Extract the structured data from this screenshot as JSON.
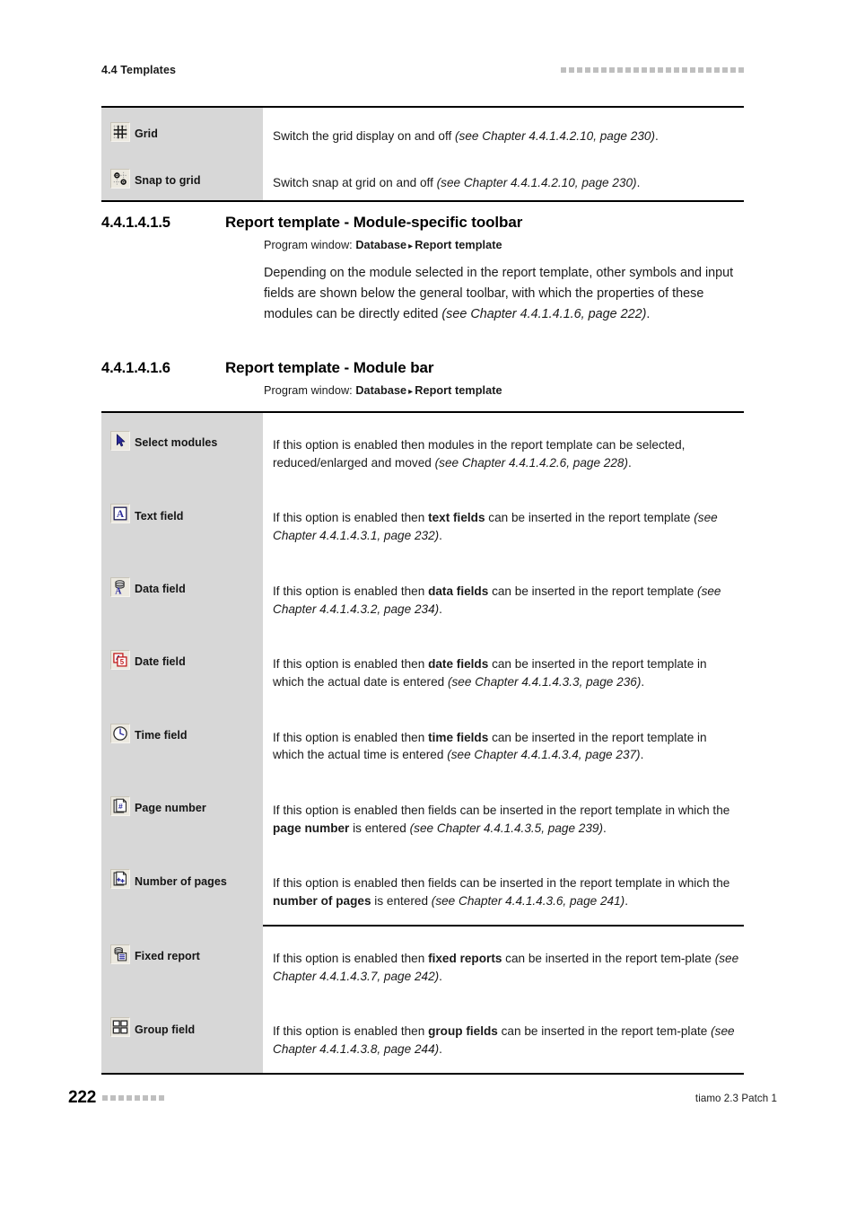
{
  "header": {
    "title": "4.4 Templates",
    "decoration_squares": 23
  },
  "footer": {
    "page_number": "222",
    "decoration_squares": 8,
    "product": "tiamo 2.3 Patch 1"
  },
  "top_table": {
    "rows": [
      {
        "icon": "grid-icon",
        "label": "Grid",
        "desc_pre": "Switch the grid display on and off ",
        "desc_ref": "(see Chapter 4.4.1.4.2.10, page 230)",
        "desc_post": "."
      },
      {
        "icon": "snap-to-grid-icon",
        "label": "Snap to grid",
        "desc_pre": "Switch snap at grid on and off ",
        "desc_ref": "(see Chapter 4.4.1.4.2.10, page 230)",
        "desc_post": "."
      }
    ]
  },
  "section_5": {
    "number": "4.4.1.4.1.5",
    "title": "Report template - Module-specific toolbar",
    "program_window_label": "Program window:",
    "program_window_path_1": "Database",
    "program_window_arrow": "▸",
    "program_window_path_2": "Report template",
    "paragraph_pre": "Depending on the module selected in the report template, other symbols and input fields are shown below the general toolbar, with which the properties of these modules can be directly edited ",
    "paragraph_ref": "(see Chapter 4.4.1.4.1.6, page 222)",
    "paragraph_post": "."
  },
  "section_6": {
    "number": "4.4.1.4.1.6",
    "title": "Report template - Module bar",
    "program_window_label": "Program window:",
    "program_window_path_1": "Database",
    "program_window_arrow": "▸",
    "program_window_path_2": "Report template"
  },
  "module_bar_table": {
    "rows": [
      {
        "icon": "select-modules-cursor-icon",
        "label": "Select modules",
        "parts": [
          {
            "text": "If this option is enabled then modules in the report template can be selected, reduced/enlarged and moved ",
            "style": "normal"
          },
          {
            "text": "(see Chapter 4.4.1.4.2.6, page 228)",
            "style": "italic"
          },
          {
            "text": ".",
            "style": "normal"
          }
        ],
        "separator_above": false
      },
      {
        "icon": "text-field-icon",
        "label": "Text field",
        "parts": [
          {
            "text": "If this option is enabled then ",
            "style": "normal"
          },
          {
            "text": "text fields",
            "style": "bold"
          },
          {
            "text": " can be inserted in the report template ",
            "style": "normal"
          },
          {
            "text": "(see Chapter 4.4.1.4.3.1, page 232)",
            "style": "italic"
          },
          {
            "text": ".",
            "style": "normal"
          }
        ],
        "separator_above": false
      },
      {
        "icon": "data-field-icon",
        "label": "Data field",
        "parts": [
          {
            "text": "If this option is enabled then ",
            "style": "normal"
          },
          {
            "text": "data fields",
            "style": "bold"
          },
          {
            "text": " can be inserted in the report template ",
            "style": "normal"
          },
          {
            "text": "(see Chapter 4.4.1.4.3.2, page 234)",
            "style": "italic"
          },
          {
            "text": ".",
            "style": "normal"
          }
        ],
        "separator_above": false
      },
      {
        "icon": "date-field-icon",
        "label": "Date field",
        "parts": [
          {
            "text": "If this option is enabled then ",
            "style": "normal"
          },
          {
            "text": "date fields",
            "style": "bold"
          },
          {
            "text": " can be inserted in the report template in which the actual date is entered ",
            "style": "normal"
          },
          {
            "text": "(see Chapter 4.4.1.4.3.3, page 236)",
            "style": "italic"
          },
          {
            "text": ".",
            "style": "normal"
          }
        ],
        "separator_above": false
      },
      {
        "icon": "time-field-clock-icon",
        "label": "Time field",
        "parts": [
          {
            "text": "If this option is enabled then ",
            "style": "normal"
          },
          {
            "text": "time fields",
            "style": "bold"
          },
          {
            "text": " can be inserted in the report template in which the actual time is entered ",
            "style": "normal"
          },
          {
            "text": "(see Chapter 4.4.1.4.3.4, page 237)",
            "style": "italic"
          },
          {
            "text": ".",
            "style": "normal"
          }
        ],
        "separator_above": false
      },
      {
        "icon": "page-number-icon",
        "label": "Page number",
        "parts": [
          {
            "text": "If this option is enabled then fields can be inserted in the report template in which the ",
            "style": "normal"
          },
          {
            "text": "page number",
            "style": "bold"
          },
          {
            "text": " is entered ",
            "style": "normal"
          },
          {
            "text": "(see Chapter 4.4.1.4.3.5, page 239)",
            "style": "italic"
          },
          {
            "text": ".",
            "style": "normal"
          }
        ],
        "separator_above": false
      },
      {
        "icon": "number-of-pages-icon",
        "label": "Number of pages",
        "parts": [
          {
            "text": "If this option is enabled then fields can be inserted in the report template in which the ",
            "style": "normal"
          },
          {
            "text": "number of pages",
            "style": "bold"
          },
          {
            "text": " is entered ",
            "style": "normal"
          },
          {
            "text": "(see Chapter 4.4.1.4.3.6, page 241)",
            "style": "italic"
          },
          {
            "text": ".",
            "style": "normal"
          }
        ],
        "separator_above": false
      },
      {
        "icon": "fixed-report-icon",
        "label": "Fixed report",
        "parts": [
          {
            "text": "If this option is enabled then ",
            "style": "normal"
          },
          {
            "text": "fixed reports",
            "style": "bold"
          },
          {
            "text": " can be inserted in the report tem-plate ",
            "style": "normal"
          },
          {
            "text": "(see Chapter 4.4.1.4.3.7, page 242)",
            "style": "italic"
          },
          {
            "text": ".",
            "style": "normal"
          }
        ],
        "separator_above": true
      },
      {
        "icon": "group-field-icon",
        "label": "Group field",
        "parts": [
          {
            "text": "If this option is enabled then ",
            "style": "normal"
          },
          {
            "text": "group fields",
            "style": "bold"
          },
          {
            "text": " can be inserted in the report tem-plate ",
            "style": "normal"
          },
          {
            "text": "(see Chapter 4.4.1.4.3.8, page 244)",
            "style": "italic"
          },
          {
            "text": ".",
            "style": "normal"
          }
        ],
        "separator_above": false
      }
    ]
  },
  "colors": {
    "icon_cell_bg": "#d7d7d7",
    "rule": "#000000",
    "decoration": "#bfbfbf",
    "icon_blue": "#2b2b9c",
    "icon_red": "#c01818"
  }
}
